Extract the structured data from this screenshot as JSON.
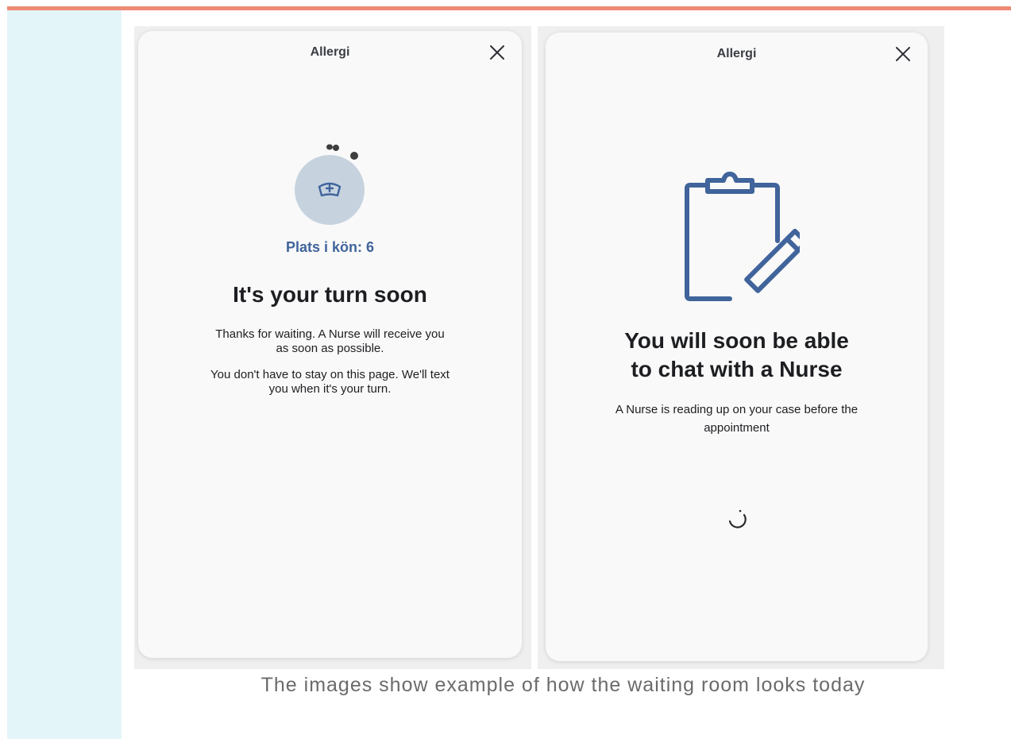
{
  "colors": {
    "accent_stripe": "#ef8a74",
    "side_band": "#e3f5f9",
    "brand_blue": "#40649b",
    "avatar_bg": "#c6d3df"
  },
  "screen_queue": {
    "title": "Allergi",
    "close_icon": "close-icon",
    "avatar_icon": "nurse-cap-icon",
    "queue_position": "Plats i kön: 6",
    "headline": "It's your turn soon",
    "paragraph_1": "Thanks for waiting. A Nurse will receive you as soon as possible.",
    "paragraph_2": "You don't have to stay on this page. We'll text you when it's your turn."
  },
  "screen_chat": {
    "title": "Allergi",
    "close_icon": "close-icon",
    "illustration_icon": "clipboard-pencil-icon",
    "headline_line_1": "You will soon be able",
    "headline_line_2": "to chat with a Nurse",
    "paragraph": "A Nurse is reading up on your case before the appointment",
    "loader_icon": "loading-spinner-icon"
  },
  "caption": "The images show example of how the waiting room looks today"
}
